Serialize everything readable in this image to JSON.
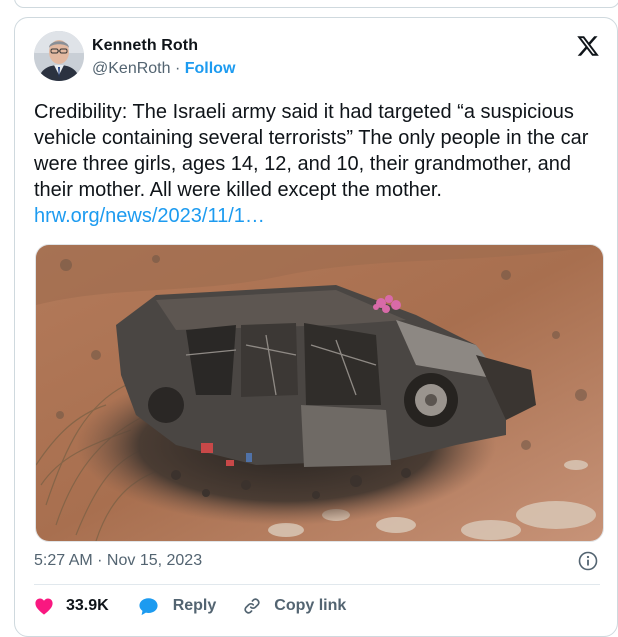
{
  "tweet": {
    "author_name": "Kenneth Roth",
    "handle": "@KenRoth",
    "separator": " · ",
    "follow_label": "Follow",
    "text": "Credibility: The Israeli army said it had targeted “a suspicious vehicle containing several terrorists” The only people in the car were three girls, ages 14, 12, and 10, their grandmother, and their mother. All were killed except the mother. ",
    "link_text": "hrw.org/news/2023/11/1…",
    "timestamp": "5:27 AM · Nov 15, 2023",
    "likes": "33.9K",
    "reply_label": "Reply",
    "copy_link_label": "Copy link"
  },
  "icons": {
    "logo": "x-logo-icon",
    "info": "info-icon",
    "like": "heart-icon",
    "reply": "speech-bubble-icon",
    "copy": "chain-link-icon"
  },
  "colors": {
    "link": "#1d9bf0",
    "heart": "#f91880",
    "secondary_text": "#536471",
    "border": "#cfd9de"
  }
}
